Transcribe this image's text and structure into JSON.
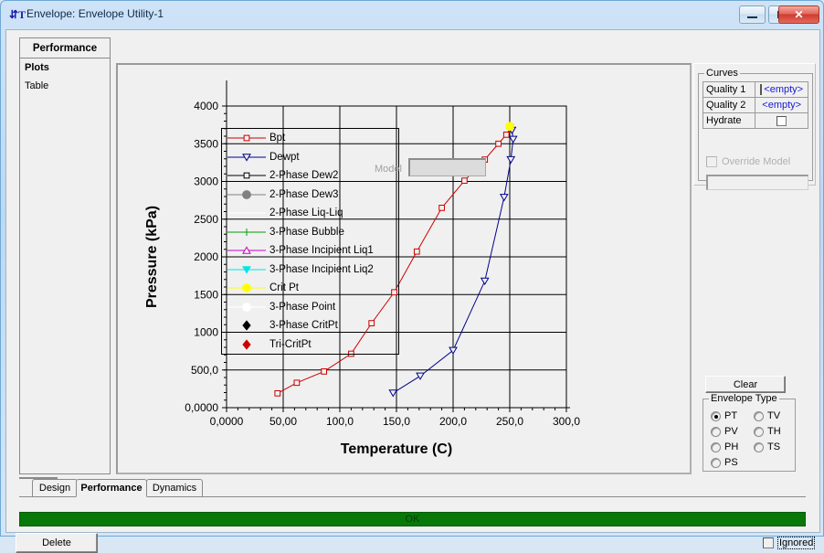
{
  "window": {
    "title": "Envelope: Envelope Utility-1",
    "icon": "flowsheet-icon",
    "buttons": {
      "minimize": "minimize-icon",
      "maximize": "maximize-icon",
      "close": "close-icon"
    }
  },
  "sidebar": {
    "tab_label": "Performance",
    "items": [
      {
        "label": "Plots",
        "selected": true
      },
      {
        "label": "Table",
        "selected": false
      }
    ]
  },
  "plot": {
    "model_label": "Model",
    "model_value": ""
  },
  "curves_panel": {
    "group_title": "Curves",
    "rows": [
      {
        "name": "Quality 1",
        "value": "<empty>",
        "type": "text",
        "focused": true
      },
      {
        "name": "Quality 2",
        "value": "<empty>",
        "type": "text",
        "focused": false
      },
      {
        "name": "Hydrate",
        "value": "",
        "type": "checkbox",
        "checked": false
      }
    ],
    "override_label": "Override Model",
    "override_checked": false,
    "override_value": ""
  },
  "clear_button": {
    "label": "Clear"
  },
  "envelope_type": {
    "group_title": "Envelope Type",
    "options": [
      {
        "label": "PT",
        "selected": true
      },
      {
        "label": "TV",
        "selected": false
      },
      {
        "label": "PV",
        "selected": false
      },
      {
        "label": "TH",
        "selected": false
      },
      {
        "label": "PH",
        "selected": false
      },
      {
        "label": "TS",
        "selected": false
      },
      {
        "label": "PS",
        "selected": false
      }
    ]
  },
  "tabs": [
    {
      "label": "Design",
      "active": false
    },
    {
      "label": "Performance",
      "active": true
    },
    {
      "label": "Dynamics",
      "active": false
    }
  ],
  "status": {
    "text": "OK",
    "color": "#087808"
  },
  "delete_button": {
    "label": "Delete"
  },
  "ignored": {
    "label": "Ignored",
    "checked": false
  },
  "chart_data": {
    "type": "line",
    "title": "",
    "xlabel": "Temperature (C)",
    "ylabel": "Pressure (kPa)",
    "xlim": [
      0,
      300
    ],
    "ylim": [
      0,
      4000
    ],
    "xticks": [
      "0,0000",
      "50,00",
      "100,0",
      "150,0",
      "200,0",
      "250,0",
      "300,0"
    ],
    "xtickvals": [
      0,
      50,
      100,
      150,
      200,
      250,
      300
    ],
    "yticks": [
      "0,0000",
      "500,0",
      "1000",
      "1500",
      "2000",
      "2500",
      "3000",
      "3500",
      "4000"
    ],
    "ytickvals": [
      0,
      500,
      1000,
      1500,
      2000,
      2500,
      3000,
      3500,
      4000
    ],
    "grid": true,
    "legend_position": "upper-left-inside",
    "series": [
      {
        "name": "Bpt",
        "color": "#cc0000",
        "marker": "square-open",
        "points": [
          [
            45,
            190
          ],
          [
            62,
            330
          ],
          [
            86,
            480
          ],
          [
            110,
            715
          ],
          [
            128,
            1120
          ],
          [
            148,
            1530
          ],
          [
            168,
            2070
          ],
          [
            190,
            2650
          ],
          [
            210,
            3010
          ],
          [
            228,
            3290
          ],
          [
            240,
            3500
          ],
          [
            247,
            3620
          ],
          [
            251,
            3720
          ]
        ]
      },
      {
        "name": "Dewpt",
        "color": "#00008b",
        "marker": "triangle-down-open",
        "points": [
          [
            147,
            195
          ],
          [
            171,
            420
          ],
          [
            200,
            760
          ],
          [
            228,
            1680
          ],
          [
            245,
            2790
          ],
          [
            251,
            3290
          ],
          [
            253,
            3560
          ],
          [
            252,
            3680
          ]
        ]
      },
      {
        "name": "2-Phase Dew2",
        "color": "#000000",
        "marker": "square-open",
        "points": []
      },
      {
        "name": "2-Phase Dew3",
        "color": "#808080",
        "marker": "circle-filled",
        "points": []
      },
      {
        "name": "2-Phase Liq-Liq",
        "color": "#ffffff",
        "marker": "none",
        "points": []
      },
      {
        "name": "3-Phase Bubble",
        "color": "#00a000",
        "marker": "plus",
        "points": []
      },
      {
        "name": "3-Phase Incipient Liq1",
        "color": "#cc00cc",
        "marker": "triangle-up-open",
        "points": []
      },
      {
        "name": "3-Phase Incipient Liq2",
        "color": "#00e5e5",
        "marker": "triangle-down-filled",
        "points": []
      },
      {
        "name": "Crit Pt",
        "color": "#ffff00",
        "marker": "circle-filled",
        "points": [
          [
            250,
            3730
          ]
        ]
      },
      {
        "name": "3-Phase Point",
        "color": "#ffffff",
        "marker": "circle-filled",
        "points": []
      },
      {
        "name": "3-Phase CritPt",
        "color": "#000000",
        "marker": "diamond-filled",
        "points": []
      },
      {
        "name": "Tri-CritPt",
        "color": "#cc0000",
        "marker": "diamond-filled",
        "points": []
      }
    ]
  }
}
